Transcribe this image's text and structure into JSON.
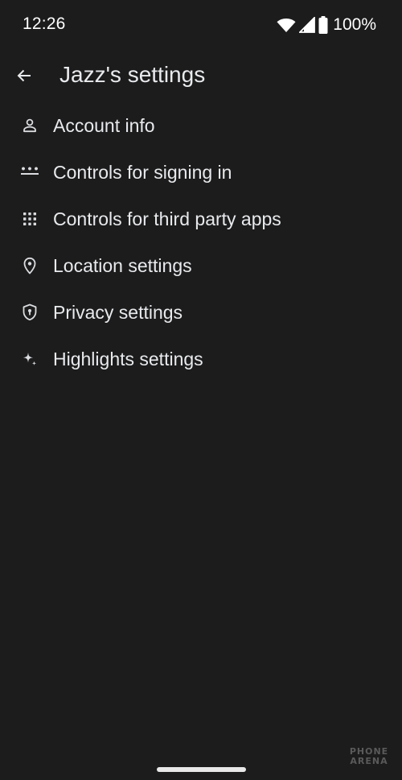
{
  "status_bar": {
    "time": "12:26",
    "battery_text": "100%",
    "icons": [
      "wifi-icon",
      "cellular-signal-icon",
      "battery-icon"
    ]
  },
  "header": {
    "title": "Jazz's settings",
    "back_icon": "arrow-back-icon"
  },
  "settings": {
    "items": [
      {
        "label": "Account info",
        "icon": "person-icon"
      },
      {
        "label": "Controls for signing in",
        "icon": "password-icon"
      },
      {
        "label": "Controls for third party apps",
        "icon": "apps-grid-icon"
      },
      {
        "label": "Location settings",
        "icon": "location-pin-icon"
      },
      {
        "label": "Privacy settings",
        "icon": "privacy-shield-icon"
      },
      {
        "label": "Highlights settings",
        "icon": "sparkle-icon"
      }
    ]
  },
  "watermark": {
    "line1": "PHONE",
    "line2": "ARENA"
  },
  "colors": {
    "background": "#1c1c1c",
    "text": "#e8eaed",
    "icon": "#dadce0"
  }
}
